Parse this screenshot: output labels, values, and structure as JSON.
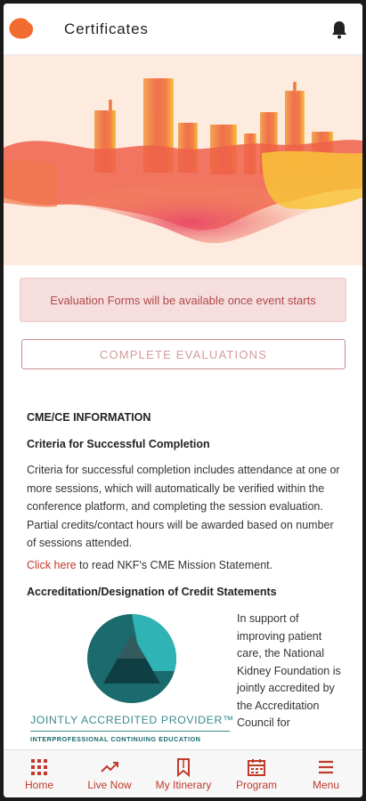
{
  "header": {
    "title": "Certificates",
    "logo_icon": "brand-blob-icon",
    "notifications_icon": "bell-icon"
  },
  "banner": {
    "text": "Evaluation Forms will be available once event starts"
  },
  "evaluations_button": {
    "label": "COMPLETE EVALUATIONS"
  },
  "cme": {
    "heading": "CME/CE INFORMATION",
    "criteria_heading": "Criteria for Successful Completion",
    "criteria_text": "Criteria for successful completion includes attendance at one or more sessions, which will automatically be verified within the conference platform, and completing the session evaluation. Partial credits/contact hours will be awarded based on number of sessions attended.",
    "link_text": "Click here",
    "link_suffix": " to read NKF's CME Mission Statement.",
    "accreditation_heading": "Accreditation/Designation of Credit Statements",
    "accreditation_text": "In support of improving patient care, the National Kidney Foundation is jointly accredited by the Accreditation Council for",
    "logo_title": "JOINTLY ACCREDITED PROVIDER™",
    "logo_subtitle": "INTERPROFESSIONAL CONTINUING EDUCATION"
  },
  "nav": {
    "items": [
      {
        "label": "Home",
        "icon": "grid-icon"
      },
      {
        "label": "Live Now",
        "icon": "trending-icon"
      },
      {
        "label": "My Itinerary",
        "icon": "bookmark-icon"
      },
      {
        "label": "Program",
        "icon": "calendar-icon"
      },
      {
        "label": "Menu",
        "icon": "hamburger-icon"
      }
    ]
  },
  "colors": {
    "accent": "#c0392b",
    "banner_bg": "#f6dede",
    "hero_bg": "#fdebe0",
    "jap_teal": "#1b6a6e"
  }
}
